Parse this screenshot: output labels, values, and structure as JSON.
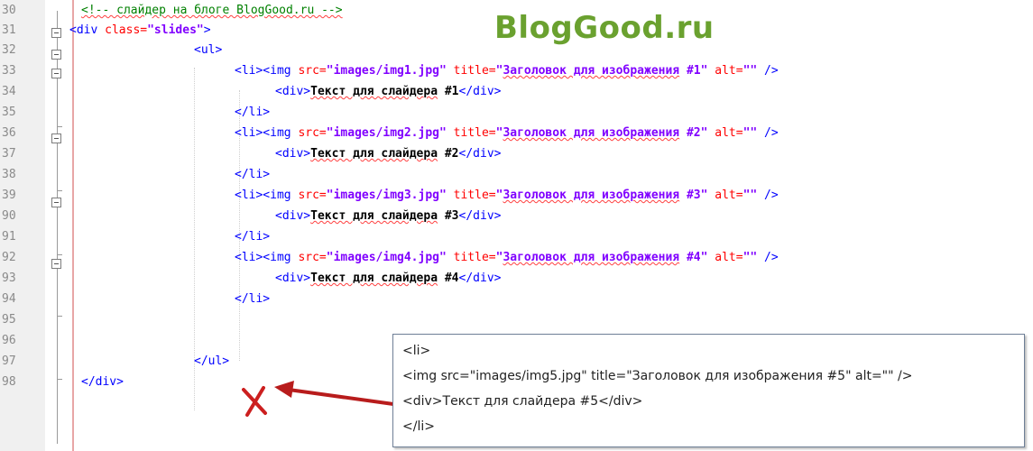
{
  "brand": "BlogGood.ru",
  "line_numbers": [
    "30",
    "31",
    "32",
    "33",
    "34",
    "35",
    "36",
    "37",
    "38",
    "39",
    "90",
    "91",
    "92",
    "93",
    "94",
    "95",
    "96",
    "97",
    "98"
  ],
  "code": {
    "comment": "<!-- слайдер на блоге BlogGood.ru -->",
    "div_open": {
      "tag": "<div ",
      "attr": "class=",
      "val": "\"slides\"",
      "close": ">"
    },
    "ul_open": "<ul>",
    "ul_close": "</ul>",
    "div_close": "</div>",
    "li_close": "</li>",
    "items": [
      {
        "li_img": "<li><img ",
        "src_attr": "src=",
        "src_val": "\"images/img1.jpg\"",
        "title_attr": " title=",
        "title_q": "\"",
        "title_text": "Заголовок для изображения",
        "title_num": " #1\"",
        "alt": " alt=",
        "alt_val": "\"\"",
        "end": " />",
        "div_open": "<div>",
        "text": "Текст для слайдера",
        "num": " #1",
        "div_close": "</div>"
      },
      {
        "li_img": "<li><img ",
        "src_attr": "src=",
        "src_val": "\"images/img2.jpg\"",
        "title_attr": " title=",
        "title_q": "\"",
        "title_text": "Заголовок для изображения",
        "title_num": " #2\"",
        "alt": " alt=",
        "alt_val": "\"\"",
        "end": " />",
        "div_open": "<div>",
        "text": "Текст для слайдера",
        "num": " #2",
        "div_close": "</div>"
      },
      {
        "li_img": "<li><img ",
        "src_attr": "src=",
        "src_val": "\"images/img3.jpg\"",
        "title_attr": " title=",
        "title_q": "\"",
        "title_text": "Заголовок для изображения",
        "title_num": " #3\"",
        "alt": " alt=",
        "alt_val": "\"\"",
        "end": " />",
        "div_open": "<div>",
        "text": "Текст для слайдера",
        "num": " #3",
        "div_close": "</div>"
      },
      {
        "li_img": "<li><img ",
        "src_attr": "src=",
        "src_val": "\"images/img4.jpg\"",
        "title_attr": " title=",
        "title_q": "\"",
        "title_text": "Заголовок для изображения",
        "title_num": " #4\"",
        "alt": " alt=",
        "alt_val": "\"\"",
        "end": " />",
        "div_open": "<div>",
        "text": "Текст для слайдера",
        "num": " #4",
        "div_close": "</div>"
      }
    ]
  },
  "popup": {
    "lines": [
      "<li>",
      "<img src=\"images/img5.jpg\" title=\"Заголовок для изображения #5\" alt=\"\" />",
      "<div>Текст для слайдера #5</div>",
      "</li>"
    ]
  },
  "colors": {
    "arrow": "#cc1f1f",
    "brand": "#6aa12f",
    "tag": "#0000ff",
    "attr": "#ff0000",
    "value": "#8000ff",
    "comment": "#008000"
  },
  "icons": {
    "insert_marker": "red-x-icon",
    "pointer": "red-arrow-icon"
  }
}
